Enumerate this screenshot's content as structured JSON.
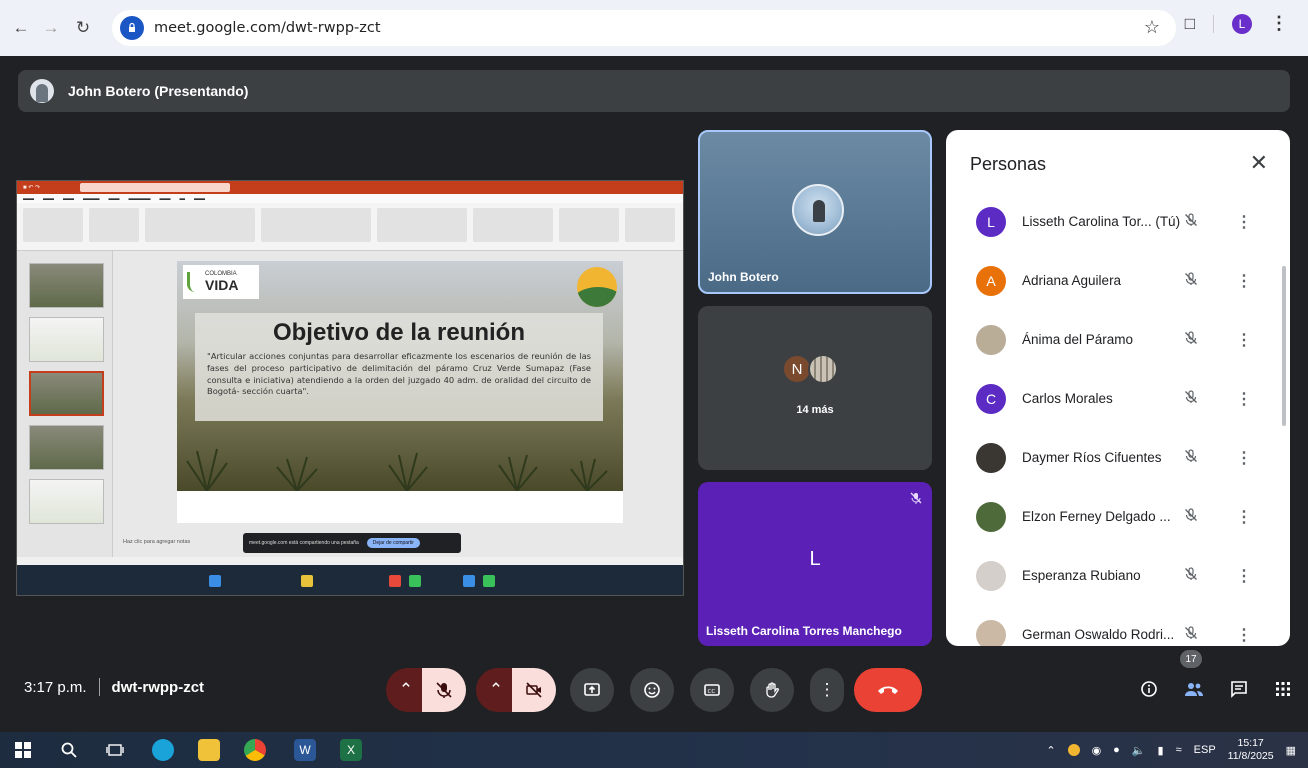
{
  "browser": {
    "url": "meet.google.com/dwt-rwpp-zct",
    "profile_initial": "L"
  },
  "presenter_bar": {
    "name": "John Botero (Presentando)"
  },
  "shared_screen": {
    "slide_title": "Objetivo de la reunión",
    "slide_quote": "\"Articular acciones conjuntas para desarrollar eficazmente los escenarios de reunión de las fases del proceso participativo de delimitación del páramo Cruz Verde Sumapaz (Fase consulta e iniciativa) atendiendo a la orden del juzgado 40 adm. de oralidad del circuito de Bogotá- sección cuarta\".",
    "logo_small": "COLOMBIA",
    "logo_big": "VIDA",
    "notes_hint": "Haz clic para agregar notas",
    "toast_text": "meet.google.com está compartiendo una pestaña",
    "toast_button": "Dejar de compartir"
  },
  "tiles": {
    "john": {
      "label": "John Botero"
    },
    "more": {
      "initial": "N",
      "label": "14 más"
    },
    "lisseth": {
      "initial": "L",
      "label": "Lisseth Carolina Torres Manchego"
    }
  },
  "people_panel": {
    "title": "Personas",
    "participants": [
      {
        "name": "Lisseth Carolina Tor... (Tú)",
        "initial": "L",
        "color": "#5b2bc4"
      },
      {
        "name": "Adriana Aguilera",
        "initial": "A",
        "color": "#e8710a"
      },
      {
        "name": "Ánima del Páramo",
        "initial": "",
        "color": "#b9ad98"
      },
      {
        "name": "Carlos Morales",
        "initial": "C",
        "color": "#5b2bc4"
      },
      {
        "name": "Daymer Ríos Cifuentes",
        "initial": "",
        "color": "#3a3632"
      },
      {
        "name": "Elzon Ferney Delgado ...",
        "initial": "",
        "color": "#4f6a3a"
      },
      {
        "name": "Esperanza Rubiano",
        "initial": "",
        "color": "#d4cfcb"
      },
      {
        "name": "German Oswaldo Rodri...",
        "initial": "",
        "color": "#cbb9a6"
      }
    ]
  },
  "meeting": {
    "time": "3:17 p.m.",
    "code": "dwt-rwpp-zct",
    "participant_count": "17"
  },
  "taskbar": {
    "language": "ESP",
    "time": "15:17",
    "date": "11/8/2025"
  },
  "colors": {
    "meet_bg": "#202124",
    "hangup": "#ea4335",
    "accent_purple": "#5b21b6"
  }
}
